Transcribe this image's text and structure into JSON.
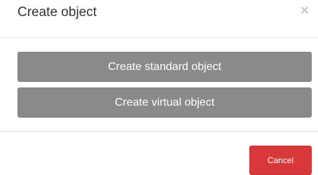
{
  "dialog": {
    "title": "Create object",
    "close_icon": "×"
  },
  "options": {
    "standard_label": "Create standard object",
    "virtual_label": "Create virtual object"
  },
  "footer": {
    "cancel_label": "Cancel"
  },
  "colors": {
    "option_button_bg": "#8a8a8a",
    "cancel_button_bg": "#d9383a",
    "close_icon_color": "#c8c8c8"
  }
}
